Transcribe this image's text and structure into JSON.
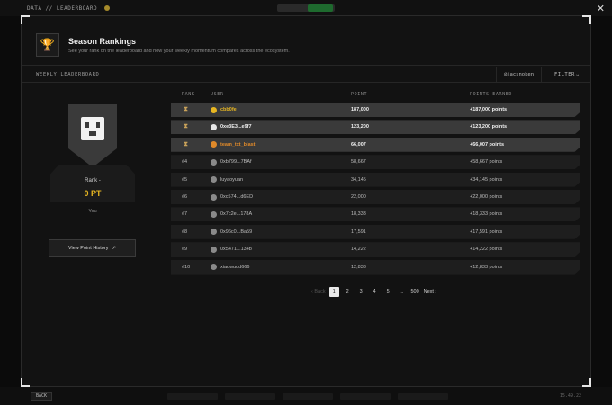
{
  "background": {
    "breadcrumb": "DATA // LEADERBOARD",
    "back_button": "BACK",
    "version": "15.49.22"
  },
  "modal": {
    "title": "Season Rankings",
    "subtitle": "See your rank on the leaderboard and how your weekly momentum compares across the ecosystem.",
    "subbar_label": "WEEKLY LEADERBOARD",
    "handle": "@jacsnoken",
    "filter_label": "FILTER",
    "close_glyph": "✕"
  },
  "profile": {
    "rank_label": "Rank -",
    "points": "0 PT",
    "you_label": "You",
    "history_button": "View Point History",
    "history_arrow": "↗"
  },
  "table": {
    "headers": {
      "rank": "RANK",
      "user": "USER",
      "point": "POINT",
      "earned": "POINTS EARNED"
    },
    "rows": [
      {
        "rank": "",
        "trophy": true,
        "user": "cbb0fe",
        "avatar": "gold",
        "name_color": "gold",
        "point": "187,000",
        "earned": "+187,000 points",
        "highlight": true
      },
      {
        "rank": "",
        "trophy": true,
        "user": "0xe3E3...e9f7",
        "avatar": "white",
        "name_color": "",
        "point": "123,200",
        "earned": "+123,200 points",
        "highlight": true
      },
      {
        "rank": "",
        "trophy": true,
        "user": "team_txt_blast",
        "avatar": "orange",
        "name_color": "orange",
        "point": "66,007",
        "earned": "+66,007 points",
        "highlight": true
      },
      {
        "rank": "#4",
        "trophy": false,
        "user": "0xb799...7BAf",
        "avatar": "grey",
        "name_color": "",
        "point": "58,667",
        "earned": "+58,667 points",
        "highlight": false
      },
      {
        "rank": "#5",
        "trophy": false,
        "user": "luyaoyuan",
        "avatar": "grey",
        "name_color": "",
        "point": "34,145",
        "earned": "+34,145 points",
        "highlight": false
      },
      {
        "rank": "#6",
        "trophy": false,
        "user": "0xc574...d6ED",
        "avatar": "grey",
        "name_color": "",
        "point": "22,000",
        "earned": "+22,000 points",
        "highlight": false
      },
      {
        "rank": "#7",
        "trophy": false,
        "user": "0x7c2e...178A",
        "avatar": "grey",
        "name_color": "",
        "point": "18,333",
        "earned": "+18,333 points",
        "highlight": false
      },
      {
        "rank": "#8",
        "trophy": false,
        "user": "0x96c0...Ba59",
        "avatar": "grey",
        "name_color": "",
        "point": "17,591",
        "earned": "+17,591 points",
        "highlight": false
      },
      {
        "rank": "#9",
        "trophy": false,
        "user": "0x5471...134b",
        "avatar": "grey",
        "name_color": "",
        "point": "14,222",
        "earned": "+14,222 points",
        "highlight": false
      },
      {
        "rank": "#10",
        "trophy": false,
        "user": "xiaowudd666",
        "avatar": "grey",
        "name_color": "",
        "point": "12,833",
        "earned": "+12,833 points",
        "highlight": false
      }
    ]
  },
  "pagination": {
    "back": "‹ Back",
    "pages": [
      "1",
      "2",
      "3",
      "4",
      "5"
    ],
    "ellipsis": "...",
    "last": "500",
    "next": "Next ›",
    "current": "1"
  },
  "colors": {
    "accent_gold": "#e7b622",
    "accent_orange": "#e08a2a",
    "modal_bg": "#121212"
  }
}
